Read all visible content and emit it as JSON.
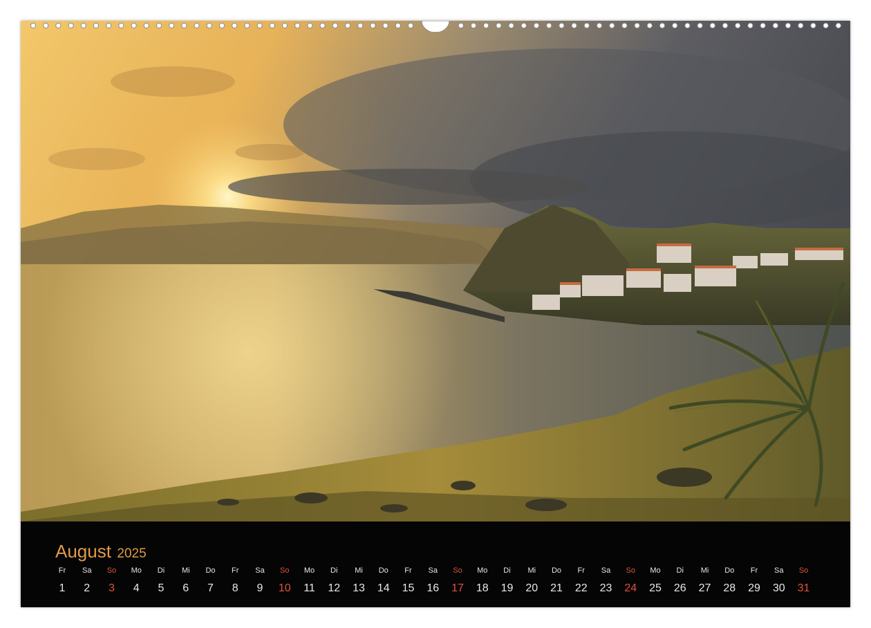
{
  "calendar": {
    "month": "August",
    "year": "2025",
    "weekend_color": "#e2533a",
    "title_color": "#e09a48",
    "days": [
      {
        "weekday": "Fr",
        "date": "1"
      },
      {
        "weekday": "Sa",
        "date": "2"
      },
      {
        "weekday": "So",
        "date": "3"
      },
      {
        "weekday": "Mo",
        "date": "4"
      },
      {
        "weekday": "Di",
        "date": "5"
      },
      {
        "weekday": "Mi",
        "date": "6"
      },
      {
        "weekday": "Do",
        "date": "7"
      },
      {
        "weekday": "Fr",
        "date": "8"
      },
      {
        "weekday": "Sa",
        "date": "9"
      },
      {
        "weekday": "So",
        "date": "10"
      },
      {
        "weekday": "Mo",
        "date": "11"
      },
      {
        "weekday": "Di",
        "date": "12"
      },
      {
        "weekday": "Mi",
        "date": "13"
      },
      {
        "weekday": "Do",
        "date": "14"
      },
      {
        "weekday": "Fr",
        "date": "15"
      },
      {
        "weekday": "Sa",
        "date": "16"
      },
      {
        "weekday": "So",
        "date": "17"
      },
      {
        "weekday": "Mo",
        "date": "18"
      },
      {
        "weekday": "Di",
        "date": "19"
      },
      {
        "weekday": "Mi",
        "date": "20"
      },
      {
        "weekday": "Do",
        "date": "21"
      },
      {
        "weekday": "Fr",
        "date": "22"
      },
      {
        "weekday": "Sa",
        "date": "23"
      },
      {
        "weekday": "So",
        "date": "24"
      },
      {
        "weekday": "Mo",
        "date": "25"
      },
      {
        "weekday": "Di",
        "date": "26"
      },
      {
        "weekday": "Mi",
        "date": "27"
      },
      {
        "weekday": "Do",
        "date": "28"
      },
      {
        "weekday": "Fr",
        "date": "29"
      },
      {
        "weekday": "Sa",
        "date": "30"
      },
      {
        "weekday": "So",
        "date": "31"
      }
    ]
  },
  "photo": {
    "subject": "coastal-sunset-landscape-icon"
  }
}
